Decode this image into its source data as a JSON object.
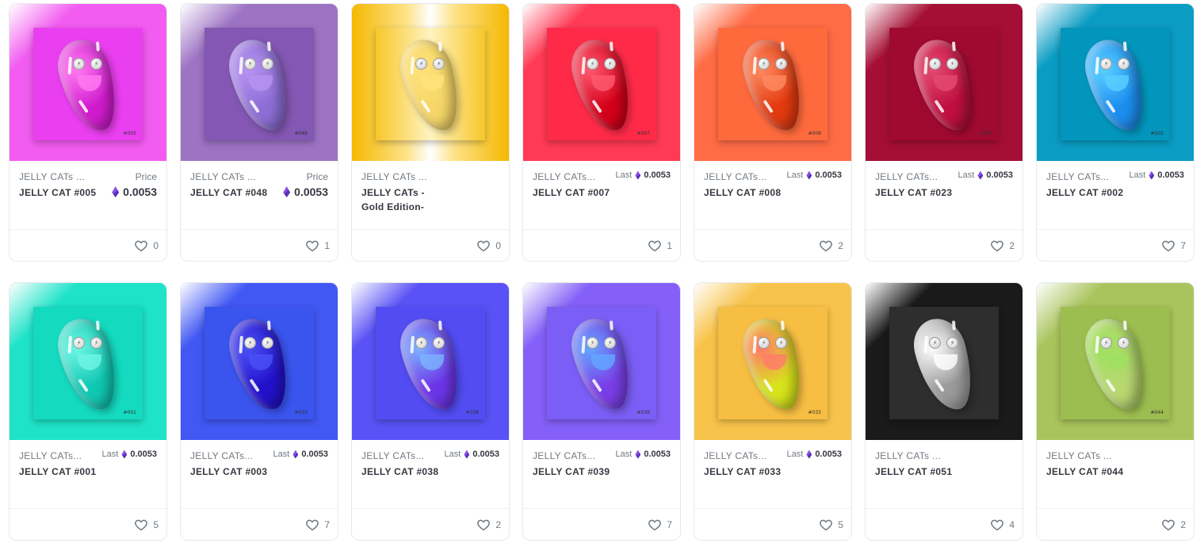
{
  "price_label": "Price",
  "last_label": "Last",
  "items": [
    {
      "collection": "JELLY CATs ...",
      "name": "JELLY CAT #005",
      "stamp": "#005",
      "price_label": "Price",
      "price": "0.0053",
      "price_type": "price",
      "likes": "0",
      "bg": "#f25cf0",
      "frame": "#ea3ff0",
      "bean": "#d21bcf",
      "mouth": "#ff7cf2"
    },
    {
      "collection": "JELLY CATs ...",
      "name": "JELLY CAT #048",
      "stamp": "#048",
      "price_label": "Price",
      "price": "0.0053",
      "price_type": "price",
      "likes": "1",
      "bg": "#9d73c4",
      "frame": "#8357b3",
      "bean": "#8d6ed6",
      "mouth": "#b793f2"
    },
    {
      "collection": "JELLY CATs ...",
      "name": "JELLY CATs - Gold Edition-",
      "stamp": "",
      "price_label": "",
      "price": "",
      "price_type": "none",
      "likes": "0",
      "bg": "#f5b800",
      "frame": "#f7d24a",
      "bean": "#f5d667",
      "mouth": "#ffe27a"
    },
    {
      "collection": "JELLY CATs...",
      "name": "JELLY CAT #007",
      "stamp": "#007",
      "price_label": "Last",
      "price": "0.0053",
      "price_type": "last",
      "likes": "1",
      "bg": "#ff3a55",
      "frame": "#ff2a48",
      "bean": "#d5001a",
      "mouth": "#ff5a70"
    },
    {
      "collection": "JELLY CATs...",
      "name": "JELLY CAT #008",
      "stamp": "#008",
      "price_label": "Last",
      "price": "0.0053",
      "price_type": "last",
      "likes": "2",
      "bg": "#ff6b45",
      "frame": "#ff6a3d",
      "bean": "#e33a10",
      "mouth": "#ff8a60"
    },
    {
      "collection": "JELLY CATs...",
      "name": "JELLY CAT #023",
      "stamp": "#023",
      "price_label": "Last",
      "price": "0.0053",
      "price_type": "last",
      "likes": "2",
      "bg": "#a60f35",
      "frame": "#a00a30",
      "bean": "#c00f40",
      "mouth": "#e44a70"
    },
    {
      "collection": "JELLY CATs...",
      "name": "JELLY CAT #002",
      "stamp": "#002",
      "price_label": "Last",
      "price": "0.0053",
      "price_type": "last",
      "likes": "7",
      "bg": "#0b9cc4",
      "frame": "#0396bd",
      "bean": "#1c8ef0",
      "mouth": "#5ad0ff"
    },
    {
      "collection": "JELLY CATs...",
      "name": "JELLY CAT #001",
      "stamp": "#001",
      "price_label": "Last",
      "price": "0.0053",
      "price_type": "last",
      "likes": "5",
      "bg": "#1ee3c8",
      "frame": "#14dac0",
      "bean": "#10c9b4",
      "mouth": "#6ff6e4"
    },
    {
      "collection": "JELLY CATs...",
      "name": "JELLY CAT #003",
      "stamp": "#003",
      "price_label": "Last",
      "price": "0.0053",
      "price_type": "last",
      "likes": "7",
      "bg": "#4158f4",
      "frame": "#3a54ee",
      "bean": "#2211cc",
      "mouth": "#4b50f5"
    },
    {
      "collection": "JELLY CATs...",
      "name": "JELLY CAT #038",
      "stamp": "#038",
      "price_label": "Last",
      "price": "0.0053",
      "price_type": "last",
      "likes": "2",
      "bg": "#5a52f6",
      "frame": "#524cf2",
      "bean": "#6c35e8",
      "mouth": "#7db3ff"
    },
    {
      "collection": "JELLY CATs...",
      "name": "JELLY CAT #039",
      "stamp": "#039",
      "price_label": "Last",
      "price": "0.0053",
      "price_type": "last",
      "likes": "7",
      "bg": "#8460f8",
      "frame": "#7b5ef5",
      "bean": "#7a3ee8",
      "mouth": "#63a7ff"
    },
    {
      "collection": "JELLY CATs...",
      "name": "JELLY CAT #033",
      "stamp": "#033",
      "price_label": "Last",
      "price": "0.0053",
      "price_type": "last",
      "likes": "5",
      "bg": "#f8c34a",
      "frame": "#f6be42",
      "bean": "#d8e41a",
      "mouth": "#ff7a6a"
    },
    {
      "collection": "JELLY CATs ...",
      "name": "JELLY CAT #051",
      "stamp": "#051",
      "price_label": "",
      "price": "",
      "price_type": "none",
      "likes": "4",
      "bg": "#1a1a1a",
      "frame": "#2e2e2e",
      "bean": "#9a9a9a",
      "mouth": "#ffffff"
    },
    {
      "collection": "JELLY CATs ...",
      "name": "JELLY CAT #044",
      "stamp": "#044",
      "price_label": "",
      "price": "",
      "price_type": "none",
      "likes": "2",
      "bg": "#a9c45c",
      "frame": "#9cbe50",
      "bean": "#b8d870",
      "mouth": "#9fe060"
    }
  ]
}
